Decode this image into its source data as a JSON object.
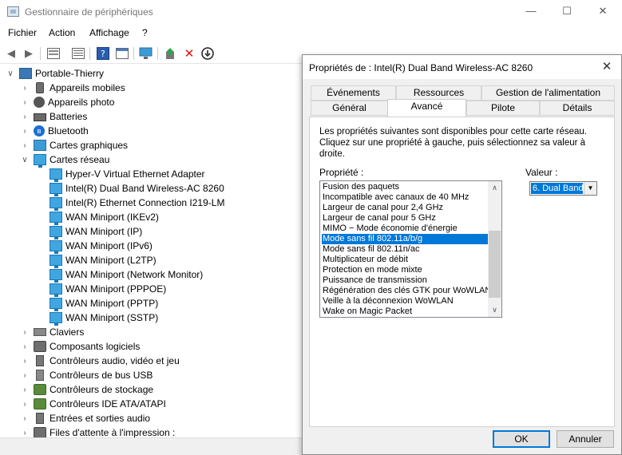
{
  "window": {
    "title": "Gestionnaire de périphériques",
    "minimize": "—",
    "maximize": "☐",
    "close": "✕"
  },
  "menu": [
    "Fichier",
    "Action",
    "Affichage",
    "?"
  ],
  "tree": {
    "root": "Portable-Thierry",
    "categories": [
      "Appareils mobiles",
      "Appareils photo",
      "Batteries",
      "Bluetooth",
      "Cartes graphiques",
      "Cartes réseau",
      "Claviers",
      "Composants logiciels",
      "Contrôleurs audio, vidéo et jeu",
      "Contrôleurs de bus USB",
      "Contrôleurs de stockage",
      "Contrôleurs IDE ATA/ATAPI",
      "Entrées et sorties audio",
      "Files d'attente à l'impression :"
    ],
    "network_adapters": [
      "Hyper-V Virtual Ethernet Adapter",
      "Intel(R) Dual Band Wireless-AC 8260",
      "Intel(R) Ethernet Connection I219-LM",
      "WAN Miniport (IKEv2)",
      "WAN Miniport (IP)",
      "WAN Miniport (IPv6)",
      "WAN Miniport (L2TP)",
      "WAN Miniport (Network Monitor)",
      "WAN Miniport (PPPOE)",
      "WAN Miniport (PPTP)",
      "WAN Miniport (SSTP)"
    ]
  },
  "dialog": {
    "title": "Propriétés de : Intel(R) Dual Band Wireless-AC 8260",
    "close": "✕",
    "tabs_row1": [
      "Événements",
      "Ressources",
      "Gestion de l'alimentation"
    ],
    "tabs_row2": [
      "Général",
      "Avancé",
      "Pilote",
      "Détails"
    ],
    "active_tab": "Avancé",
    "description": "Les propriétés suivantes sont disponibles pour cette carte réseau. Cliquez sur une propriété à gauche, puis sélectionnez sa valeur à droite.",
    "property_label": "Propriété :",
    "value_label": "Valeur :",
    "properties": [
      "Fusion des paquets",
      "Incompatible avec canaux de 40 MHz",
      "Largeur de canal pour 2,4 GHz",
      "Largeur de canal pour 5 GHz",
      "MIMO − Mode économie d'énergie",
      "Mode sans fil 802.11a/b/g",
      "Mode sans fil 802.11n/ac",
      "Multiplicateur de débit",
      "Protection en mode mixte",
      "Puissance de transmission",
      "Régénération des clés GTK pour WoWLAN",
      "Veille à la déconnexion WoWLAN",
      "Wake on Magic Packet"
    ],
    "selected_property": "Mode sans fil 802.11a/b/g",
    "value": "6. Dual Band",
    "ok": "OK",
    "cancel": "Annuler"
  }
}
